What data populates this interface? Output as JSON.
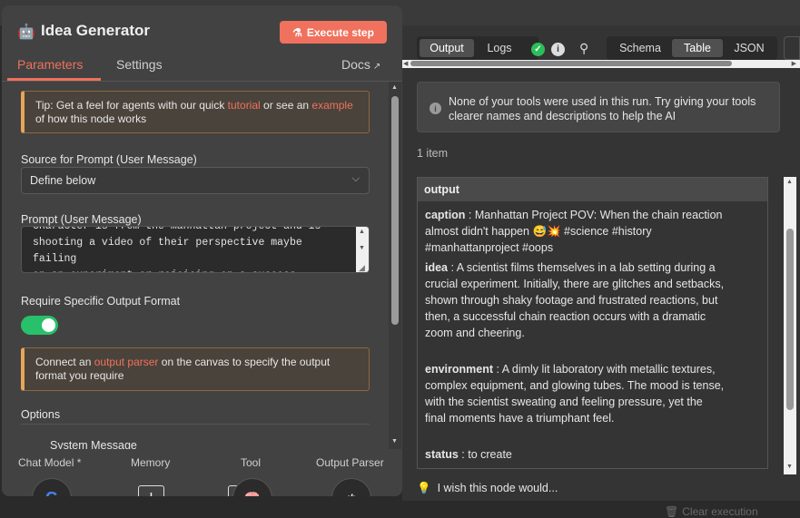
{
  "node": {
    "title": "Idea Generator",
    "execute_label": "Execute step",
    "tabs": [
      "Parameters",
      "Settings"
    ],
    "docs_label": "Docs"
  },
  "params": {
    "tip": {
      "pre": "Tip: Get a feel for agents with our quick ",
      "link1": "tutorial",
      "mid": " or see an ",
      "link2": "example",
      "post": " of how this node works"
    },
    "source_label": "Source for Prompt (User Message)",
    "source_value": "Define below",
    "prompt_label": "Prompt (User Message)",
    "prompt_text": "character is from the manhattan project and is\nshooting a video of their perspective maybe failing\non an experiment or rejoicing on a success.",
    "require_label": "Require Specific Output Format",
    "require_on": true,
    "connect": {
      "pre": "Connect an ",
      "link": "output parser",
      "post": " on the canvas to specify the output format you require"
    },
    "options_label": "Options",
    "system_message_label": "System Message"
  },
  "footer": {
    "chat_model": "Chat Model *",
    "memory": "Memory",
    "tool": "Tool",
    "output_parser": "Output Parser"
  },
  "output": {
    "tabs": [
      "Output",
      "Logs"
    ],
    "view_tabs": [
      "Schema",
      "Table",
      "JSON"
    ],
    "active_view": "Table",
    "notice": "None of your tools were used in this run. Try giving your tools clearer names and descriptions to help the AI",
    "count": "1 item",
    "column": "output",
    "rows": [
      {
        "key": "caption",
        "value": "Manhattan Project POV: When the chain reaction almost didn't happen 😅💥 #science #history #manhattanproject #oops"
      },
      {
        "key": "idea",
        "value": "A scientist films themselves in a lab setting during a crucial experiment. Initially, there are glitches and setbacks, shown through shaky footage and frustrated reactions, but then, a successful chain reaction occurs with a dramatic zoom and cheering."
      },
      {
        "key": "environment",
        "value": "A dimly lit laboratory with metallic textures, complex equipment, and glowing tubes. The mood is tense, with the scientist sweating and feeling pressure, yet the final moments have a triumphant feel."
      },
      {
        "key": "status",
        "value": "to create"
      }
    ],
    "wish": "I wish this node would..."
  },
  "canvas": {
    "clear_execution": "Clear execution"
  },
  "colors": {
    "accent": "#f0715d",
    "success": "#28c06a",
    "tip_border": "#e8a55a"
  }
}
